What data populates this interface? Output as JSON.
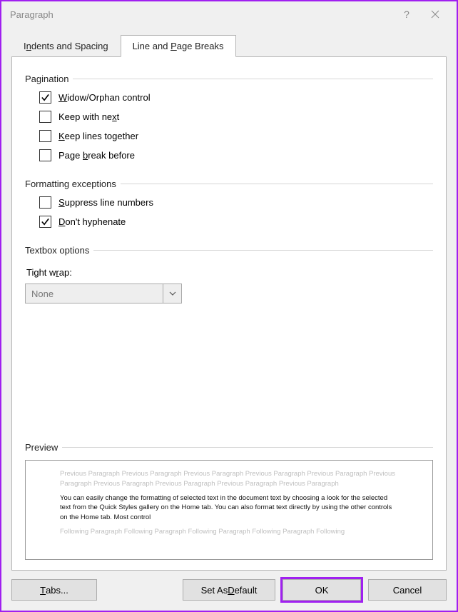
{
  "window": {
    "title": "Paragraph"
  },
  "tabs": {
    "indents": {
      "pre": "I",
      "u": "n",
      "post": "dents and Spacing"
    },
    "breaks": {
      "pre": "Line and ",
      "u": "P",
      "post": "age Breaks"
    }
  },
  "sections": {
    "pagination": "Pagination",
    "formatting": "Formatting exceptions",
    "textbox": "Textbox options",
    "preview": "Preview"
  },
  "checkboxes": {
    "widow": {
      "pre": "",
      "u": "W",
      "post": "idow/Orphan control",
      "checked": true
    },
    "keep_next": {
      "pre": "Keep with ne",
      "u": "x",
      "post": "t",
      "checked": false
    },
    "keep_tog": {
      "pre": "",
      "u": "K",
      "post": "eep lines together",
      "checked": false
    },
    "page_break": {
      "pre": "Page ",
      "u": "b",
      "post": "reak before",
      "checked": false
    },
    "suppress": {
      "pre": "",
      "u": "S",
      "post": "uppress line numbers",
      "checked": false
    },
    "hyphen": {
      "pre": "",
      "u": "D",
      "post": "on't hyphenate",
      "checked": true
    }
  },
  "tight_wrap": {
    "label": {
      "pre": "Tight w",
      "u": "r",
      "post": "ap:"
    },
    "value": "None"
  },
  "preview": {
    "before": "Previous Paragraph Previous Paragraph Previous Paragraph Previous Paragraph Previous Paragraph Previous Paragraph Previous Paragraph Previous Paragraph Previous Paragraph Previous Paragraph",
    "body": "You can easily change the formatting of selected text in the document text by choosing a look for the selected text from the Quick Styles gallery on the Home tab. You can also format text directly by using the other controls on the Home tab. Most control",
    "after": "Following Paragraph Following Paragraph Following Paragraph Following Paragraph Following"
  },
  "buttons": {
    "tabs": {
      "pre": "",
      "u": "T",
      "post": "abs..."
    },
    "default": {
      "pre": "Set As ",
      "u": "D",
      "post": "efault"
    },
    "ok": "OK",
    "cancel": "Cancel"
  }
}
